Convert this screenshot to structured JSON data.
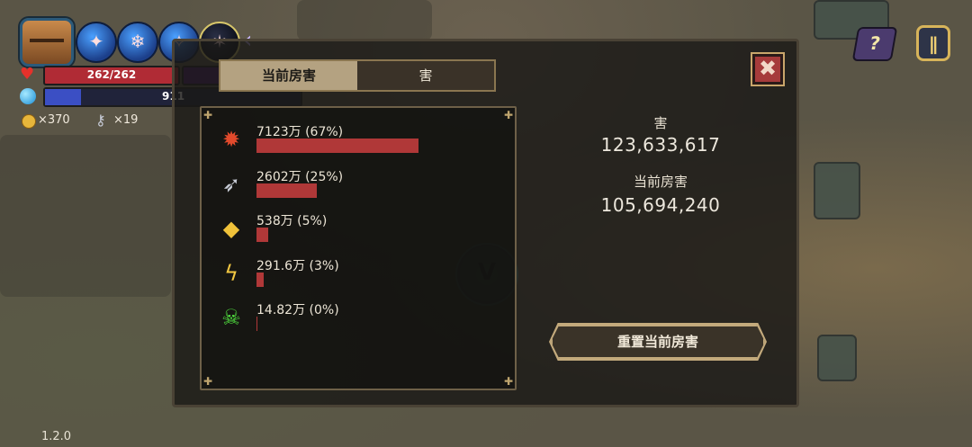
{
  "hud": {
    "hp_text": "262/262",
    "mana_text": "911",
    "gold_count": "×370",
    "key_count": "×19",
    "version": "1.2.0"
  },
  "dialog": {
    "tabs": [
      "当前房害",
      "害"
    ],
    "active_tab": "当前房害",
    "close_label": "✖",
    "damage_rows": [
      {
        "icon": "fire-burst-icon",
        "label": "7123万 (67%)",
        "percent": 67
      },
      {
        "icon": "arrow-icon",
        "label": "2602万 (25%)",
        "percent": 25
      },
      {
        "icon": "crystal-icon",
        "label": "538万 (5%)",
        "percent": 5
      },
      {
        "icon": "lightning-icon",
        "label": "291.6万 (3%)",
        "percent": 3
      },
      {
        "icon": "poison-skull-icon",
        "label": "14.82万 (0%)",
        "percent": 0
      }
    ],
    "total_title": "害",
    "total_value": "123,633,617",
    "room_title": "当前房害",
    "room_value": "105,694,240",
    "reset_label": "重置当前房害"
  },
  "colors": {
    "bar": "#b03838",
    "hp": "#b02b35",
    "mana": "#3b4fc4"
  }
}
